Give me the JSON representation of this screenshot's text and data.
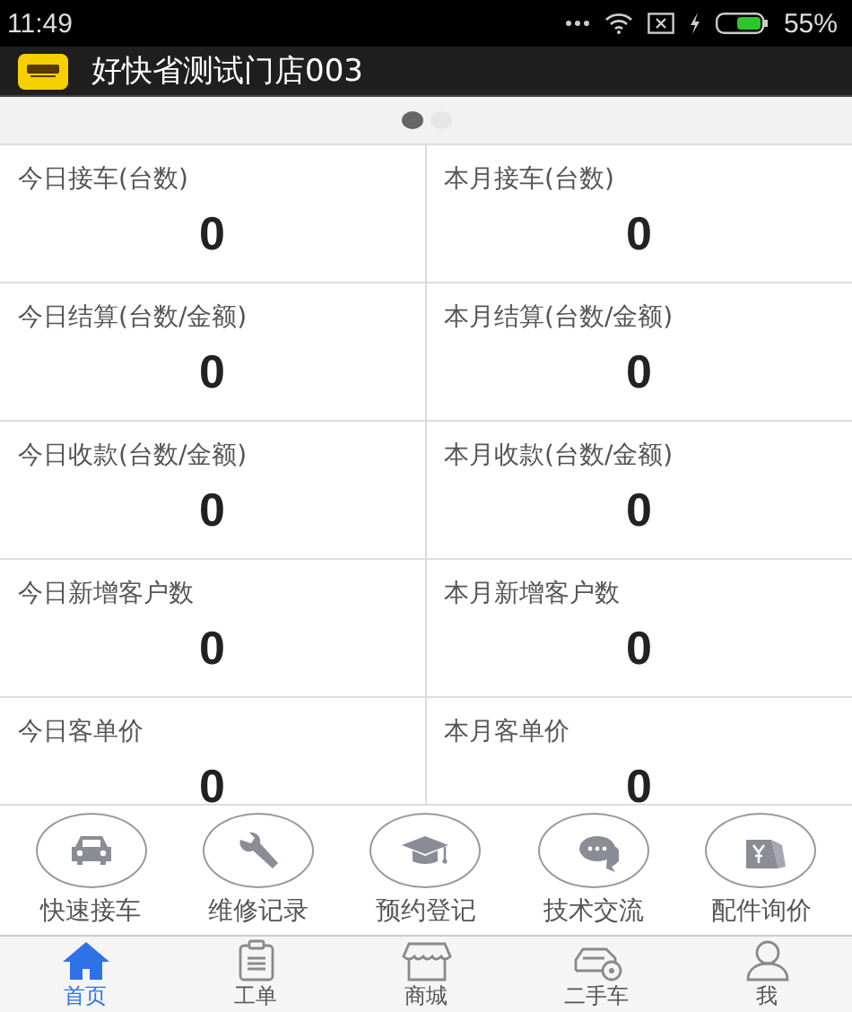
{
  "status_bar": {
    "time": "11:49",
    "battery": "55%"
  },
  "app_bar": {
    "title": "好快省测试门店003"
  },
  "pager": {
    "pages": [
      {
        "selected": true
      },
      {
        "selected": false
      }
    ]
  },
  "stats": [
    {
      "label": "今日接车(台数)",
      "value": "0"
    },
    {
      "label": "本月接车(台数)",
      "value": "0"
    },
    {
      "label": "今日结算(台数/金额)",
      "value": "0"
    },
    {
      "label": "本月结算(台数/金额)",
      "value": "0"
    },
    {
      "label": "今日收款(台数/金额)",
      "value": "0"
    },
    {
      "label": "本月收款(台数/金额)",
      "value": "0"
    },
    {
      "label": "今日新增客户数",
      "value": "0"
    },
    {
      "label": "本月新增客户数",
      "value": "0"
    },
    {
      "label": "今日客单价",
      "value": "0"
    },
    {
      "label": "本月客单价",
      "value": "0"
    }
  ],
  "shortcuts": [
    {
      "kind": "car",
      "label": "快速接车"
    },
    {
      "kind": "wrench",
      "label": "维修记录"
    },
    {
      "kind": "cap",
      "label": "预约登记"
    },
    {
      "kind": "chat",
      "label": "技术交流"
    },
    {
      "kind": "tag",
      "label": "配件询价"
    }
  ],
  "tab_bar": [
    {
      "kind": "home",
      "label": "首页",
      "selected": true
    },
    {
      "kind": "clipboard",
      "label": "工单",
      "selected": false
    },
    {
      "kind": "shop",
      "label": "商城",
      "selected": false
    },
    {
      "kind": "usedcar",
      "label": "二手车",
      "selected": false
    },
    {
      "kind": "person",
      "label": "我",
      "selected": false
    }
  ]
}
